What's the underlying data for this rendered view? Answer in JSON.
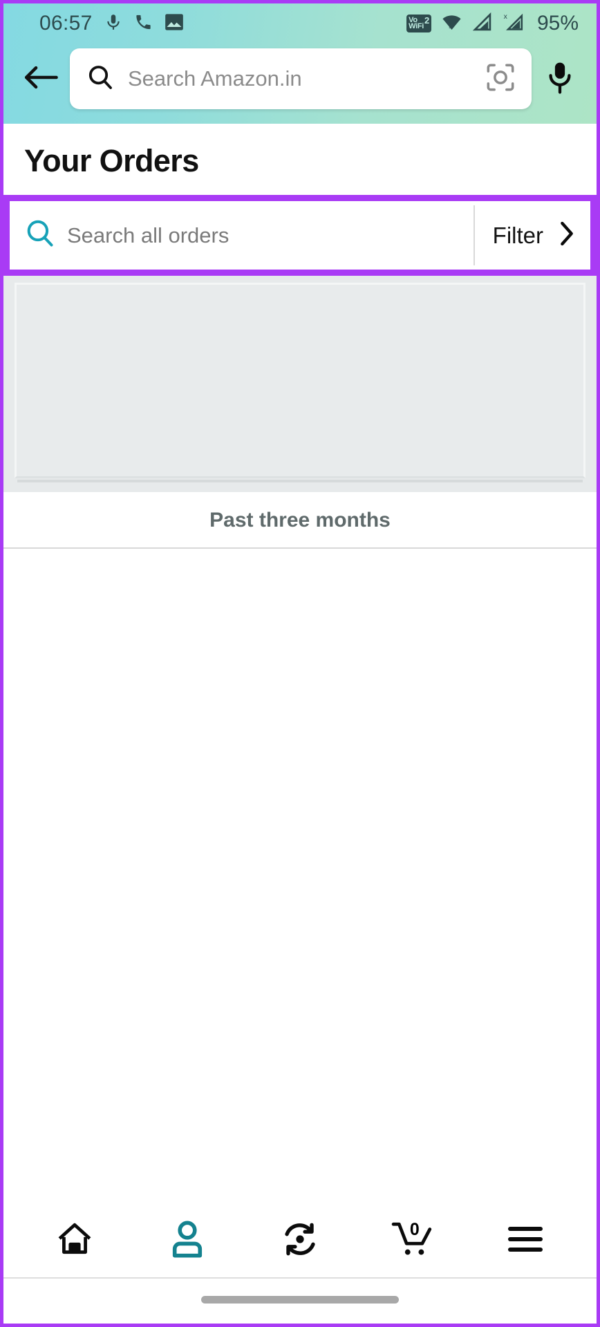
{
  "status_bar": {
    "time": "06:57",
    "battery": "95%",
    "left_icons": [
      "microphone-icon",
      "phone-call-icon",
      "image-icon"
    ],
    "right_icons": [
      "vowifi-icon",
      "wifi-icon",
      "signal-1-icon",
      "signal-2-no-sim-icon"
    ],
    "vowifi": {
      "vo": "Vo",
      "wifi": "WiFi",
      "sim": "2"
    }
  },
  "header": {
    "back_icon": "back-arrow-icon",
    "search_placeholder": "Search Amazon.in",
    "search_icon": "search-icon",
    "camera_icon": "camera-lens-scan-icon",
    "mic_icon": "microphone-icon"
  },
  "page": {
    "title": "Your Orders"
  },
  "filter_bar": {
    "search_icon": "search-icon",
    "search_placeholder": "Search all orders",
    "filter_label": "Filter",
    "chevron_icon": "chevron-right-icon",
    "highlight_color": "#A93BF5"
  },
  "orders": {
    "period_label": "Past three months",
    "placeholder_state": "loading-skeleton",
    "items": []
  },
  "bottom_nav": {
    "items": [
      {
        "name": "home",
        "icon": "home-icon",
        "active": false
      },
      {
        "name": "account",
        "icon": "person-icon",
        "active": true
      },
      {
        "name": "refresh",
        "icon": "sync-refresh-icon",
        "active": false
      },
      {
        "name": "cart",
        "icon": "shopping-cart-icon",
        "active": false,
        "badge": "0"
      },
      {
        "name": "menu",
        "icon": "hamburger-menu-icon",
        "active": false
      }
    ],
    "active_color": "#14828F"
  }
}
